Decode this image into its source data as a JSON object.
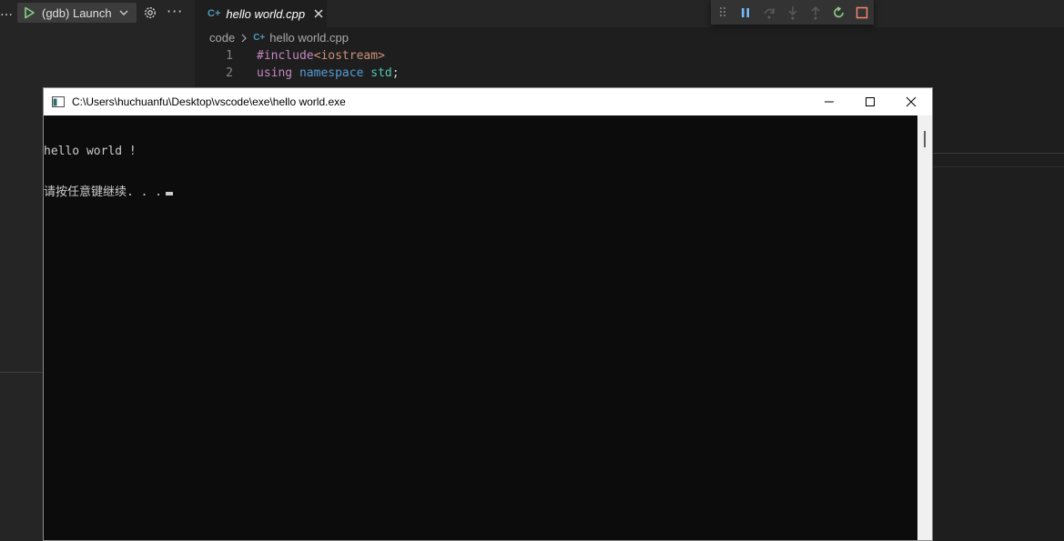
{
  "vscode": {
    "debug_config": "(gdb) Launch",
    "ellipsis_left": "…",
    "more_actions": "···",
    "tab": {
      "icon_text": "C+",
      "title": "hello world.cpp"
    },
    "breadcrumb": {
      "folder": "code",
      "file": "hello world.cpp"
    },
    "code_lines": [
      {
        "num": "1",
        "tokens": [
          {
            "text": "#include",
            "cls": "kw-pre"
          },
          {
            "text": "<iostream>",
            "cls": "kw-inc"
          }
        ]
      },
      {
        "num": "2",
        "tokens": [
          {
            "text": "using",
            "cls": "kw-pre"
          },
          {
            "text": " ",
            "cls": "plain"
          },
          {
            "text": "namespace",
            "cls": "kw-blue"
          },
          {
            "text": " ",
            "cls": "plain"
          },
          {
            "text": "std",
            "cls": "kw-ns"
          },
          {
            "text": ";",
            "cls": "plain"
          }
        ]
      }
    ],
    "debug_toolbar_icons": [
      "drag-handle-icon",
      "pause-icon",
      "step-over-icon",
      "step-into-icon",
      "step-out-icon",
      "restart-icon",
      "stop-icon"
    ]
  },
  "console": {
    "title": "C:\\Users\\huchuanfu\\Desktop\\vscode\\exe\\hello world.exe",
    "output_lines": [
      "hello world !",
      "请按任意键继续. . ."
    ]
  },
  "colors": {
    "restart": "#89d185",
    "stop": "#f48771",
    "pause": "#75beff",
    "console_bg": "#0c0c0c"
  }
}
